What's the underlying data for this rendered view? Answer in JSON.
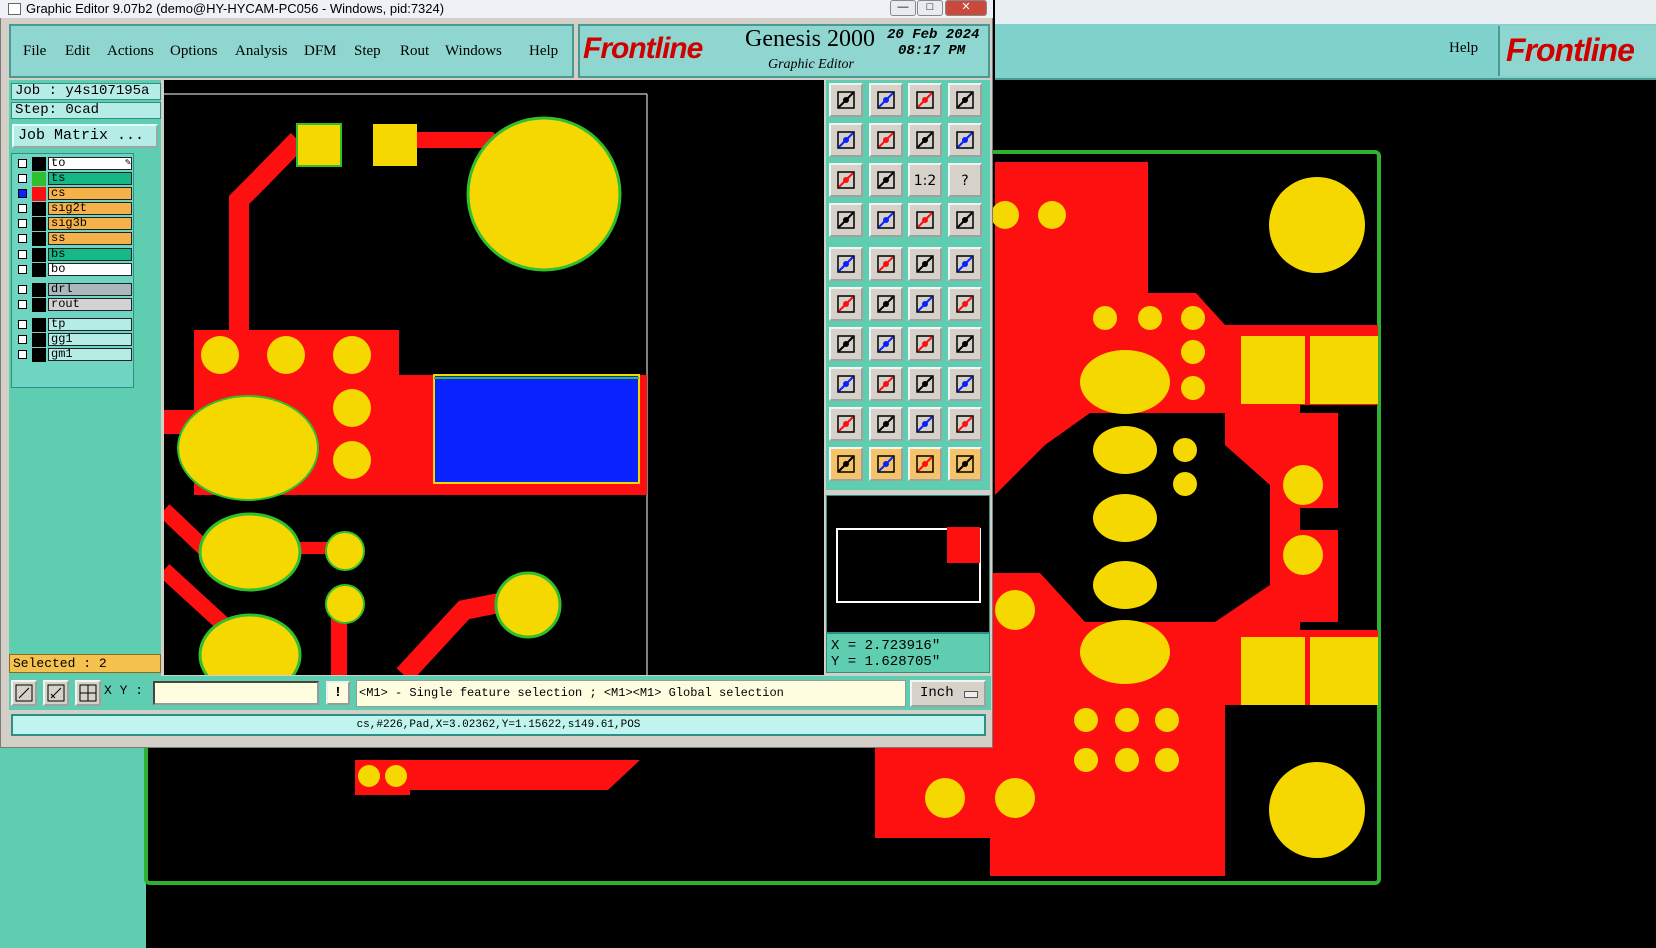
{
  "window": {
    "title": "Graphic Editor 9.07b2 (demo@HY-HYCAM-PC056 - Windows, pid:7324)",
    "buttons": {
      "minimize": "—",
      "maximize": "□",
      "close": "✕"
    }
  },
  "menu": {
    "items": [
      "File",
      "Edit",
      "Actions",
      "Options",
      "Analysis",
      "DFM",
      "Step",
      "Rout",
      "Windows"
    ],
    "help": "Help"
  },
  "branding": {
    "logo": "Frontline",
    "product": "Genesis 2000",
    "subtitle": "Graphic Editor",
    "date": "20 Feb 2024",
    "time": "08:17 PM"
  },
  "background_window": {
    "help": "Help",
    "logo": "Frontline"
  },
  "job": {
    "job": "Job : y4s107195a",
    "step": "Step: 0cad",
    "matrix_button": "Job Matrix ..."
  },
  "layers": [
    {
      "name": "to",
      "color": "#ffffff",
      "mark": "✎"
    },
    {
      "name": "ts",
      "color": "#17b887",
      "mark": ""
    },
    {
      "name": "cs",
      "color": "#f5b24a",
      "mark": ""
    },
    {
      "name": "sig2t",
      "color": "#f5b24a",
      "mark": ""
    },
    {
      "name": "sig3b",
      "color": "#f5b24a",
      "mark": ""
    },
    {
      "name": "ss",
      "color": "#f5b24a",
      "mark": ""
    },
    {
      "name": "bs",
      "color": "#17b887",
      "mark": ""
    },
    {
      "name": "bo",
      "color": "#ffffff",
      "mark": ""
    },
    {
      "name": "drl",
      "color": "#a8b8bd",
      "mark": ""
    },
    {
      "name": "rout",
      "color": "#d3d3d3",
      "mark": ""
    },
    {
      "name": "tp",
      "color": "#b6ece6",
      "mark": ""
    },
    {
      "name": "gg1",
      "color": "#b6ece6",
      "mark": ""
    },
    {
      "name": "gm1",
      "color": "#b6ece6",
      "mark": ""
    }
  ],
  "selection": {
    "text": "Selected : 2"
  },
  "coords": {
    "x": "X = 2.723916\"",
    "y": "Y = 1.628705\""
  },
  "input": {
    "label": "X Y :",
    "value": ""
  },
  "message": "<M1> - Single feature selection ; <M1><M1> Global selection",
  "units": "Inch",
  "status": "cs,#226,Pad,X=3.02362,Y=1.15622,s149.61,POS",
  "toolbox": {
    "rows": [
      [
        "open-step-icon",
        "save-icon",
        "home-icon",
        "split-view-icon"
      ],
      [
        "pan-left-icon",
        "pan-right-icon",
        "undo-view-icon",
        "redraw-icon"
      ],
      [
        "zoom-fit-icon",
        "zoom-home-icon",
        "zoom-1-2-icon",
        "help-icon"
      ],
      [
        "display-options-icon",
        "grid-icon",
        "snap-red-icon",
        "snap-mode-icon"
      ],
      [
        "pad-select-icon",
        "copy-shape-icon",
        "measure-ruler-icon",
        "pad-round-icon"
      ],
      [
        "connect-icon",
        "delete-icon",
        "point-connect-icon",
        "point-to-point-icon"
      ],
      [
        "line-angle-icon",
        "line-draw-icon",
        "arc-icon",
        "layer-flip-icon"
      ],
      [
        "move-red-icon",
        "line-red-icon",
        "resize-icon",
        "surface-icon"
      ],
      [
        "polygon-red-icon",
        "polygon-blue-icon",
        "polygon-outline-icon",
        "polygon-cut-icon"
      ],
      [
        "select-arrow-icon",
        "select-box-icon",
        "select-rotate-icon",
        "select-path-icon"
      ]
    ],
    "active_row": 9,
    "label_1_2": "1:2",
    "label_help": "?"
  },
  "bottom_buttons": [
    "zoom-box-icon",
    "zoom-out-icon",
    "zoom-grid-icon"
  ],
  "msg_button": "!"
}
